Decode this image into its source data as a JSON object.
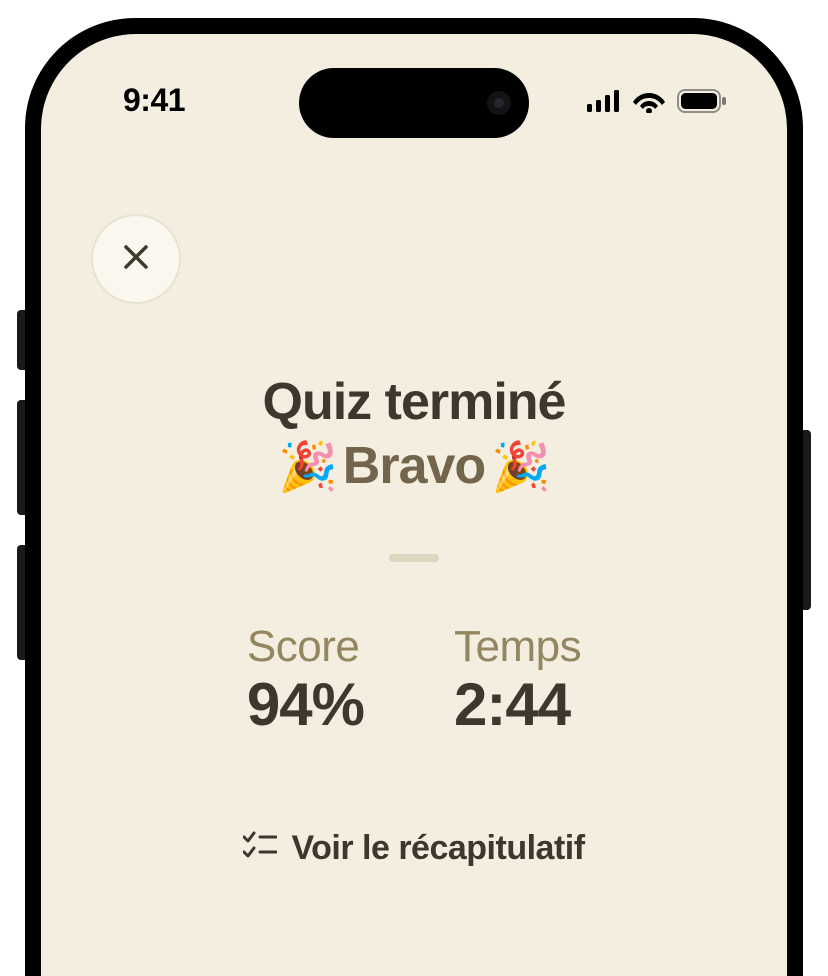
{
  "status_bar": {
    "time": "9:41"
  },
  "header": {
    "title_line1": "Quiz terminé",
    "title_line2": "Bravo",
    "celebration_emoji": "🎉"
  },
  "stats": {
    "score": {
      "label": "Score",
      "value": "94%"
    },
    "time": {
      "label": "Temps",
      "value": "2:44"
    }
  },
  "actions": {
    "recap_label": "Voir le récapitulatif"
  }
}
